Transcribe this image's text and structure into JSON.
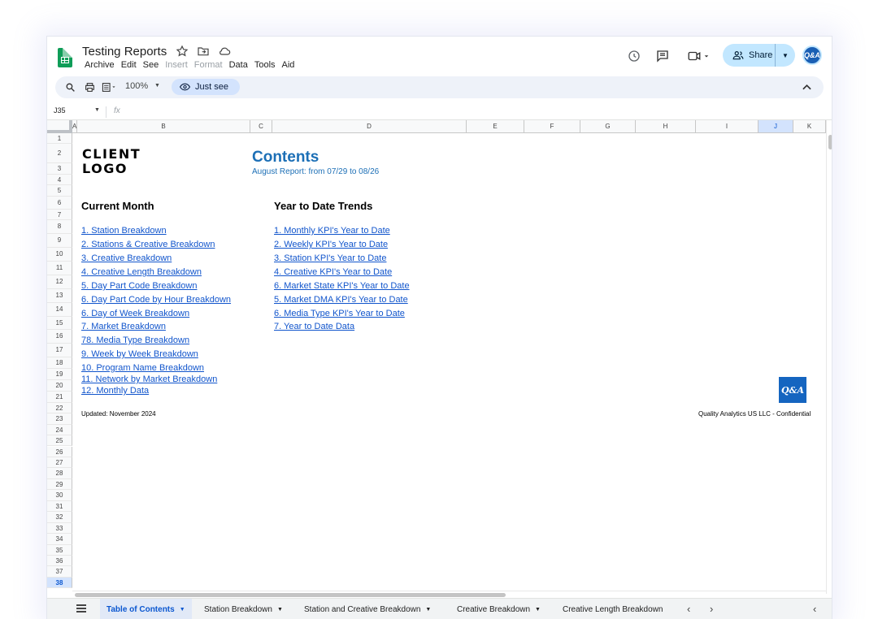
{
  "app": {
    "title": "Testing Reports",
    "menu": [
      {
        "label": "Archive",
        "disabled": false
      },
      {
        "label": "Edit",
        "disabled": false
      },
      {
        "label": "See",
        "disabled": false
      },
      {
        "label": "Insert",
        "disabled": true
      },
      {
        "label": "Format",
        "disabled": true
      },
      {
        "label": "Data",
        "disabled": false
      },
      {
        "label": "Tools",
        "disabled": false
      },
      {
        "label": "Aid",
        "disabled": false
      }
    ],
    "share_label": "Share",
    "avatar_text": "Q&A"
  },
  "toolbar": {
    "zoom": "100%",
    "view_mode": "Just see"
  },
  "formula_bar": {
    "name_box": "J35",
    "fx": "fx"
  },
  "grid": {
    "columns": [
      {
        "label": "A",
        "selected": false
      },
      {
        "label": "B",
        "selected": false
      },
      {
        "label": "C",
        "selected": false
      },
      {
        "label": "D",
        "selected": false
      },
      {
        "label": "E",
        "selected": false
      },
      {
        "label": "F",
        "selected": false
      },
      {
        "label": "G",
        "selected": false
      },
      {
        "label": "H",
        "selected": false
      },
      {
        "label": "I",
        "selected": false
      },
      {
        "label": "J",
        "selected": true
      },
      {
        "label": "K",
        "selected": false
      }
    ],
    "rows": [
      "1",
      "2",
      "3",
      "4",
      "5",
      "6",
      "7",
      "8",
      "9",
      "10",
      "11",
      "12",
      "13",
      "14",
      "15",
      "16",
      "17",
      "18",
      "19",
      "20",
      "21",
      "22",
      "23",
      "24",
      "25",
      "26",
      "27",
      "28",
      "29",
      "30",
      "31",
      "32",
      "33",
      "34",
      "35",
      "36",
      "37",
      "38"
    ],
    "selected_row": "38"
  },
  "sheet": {
    "client_logo_line1": "CLIENT",
    "client_logo_line2": "LOGO",
    "title": "Contents",
    "subtitle": "August Report: from 07/29 to 08/26",
    "current_month_heading": "Current Month",
    "ytd_heading": "Year  to Date Trends",
    "current_month_links": [
      "1. Station Breakdown",
      "2. Stations & Creative Breakdown",
      "3. Creative Breakdown",
      "4. Creative Length Breakdown",
      "5. Day Part Code Breakdown",
      "6. Day Part Code by Hour Breakdown",
      "6. Day of Week Breakdown",
      "7. Market Breakdown",
      "78. Media Type Breakdown",
      "9. Week by Week Breakdown",
      "10. Program Name Breakdown",
      "11. Network by Market Breakdown",
      "12. Monthly Data"
    ],
    "ytd_links": [
      "1. Monthly KPI's Year to Date",
      "2. Weekly KPI's Year to Date",
      "3. Station KPI's Year to Date",
      "4. Creative KPI's Year to Date",
      "6. Market State  KPI's Year to Date",
      "5. Market DMA  KPI's Year to Date",
      "6. Media Type KPI's Year to Date",
      "7. Year to Date Data"
    ],
    "updated": "Updated: November 2024",
    "confidential": "Quality Analytics US LLC - Confidential",
    "qa_logo_text": "Q&A"
  },
  "tabs": [
    {
      "label": "Table of Contents",
      "active": true
    },
    {
      "label": "Station Breakdown",
      "active": false
    },
    {
      "label": "Station and Creative Breakdown",
      "active": false
    },
    {
      "label": "Creative Breakdown",
      "active": false
    },
    {
      "label": "Creative Length Breakdown",
      "active": false
    }
  ],
  "colors": {
    "accent": "#0b57d0",
    "link": "#1155cc",
    "title_blue": "#1c6fb6",
    "share_bg": "#c2e7ff",
    "sheets_green": "#0f9d58"
  },
  "icons": [
    "sheets-logo-icon",
    "star-icon",
    "move-folder-icon",
    "cloud-icon",
    "history-icon",
    "comment-icon",
    "video-call-icon",
    "share-people-icon",
    "search-icon",
    "print-icon",
    "paint-format-icon",
    "eye-icon",
    "collapse-chevron-icon",
    "all-sheets-menu-icon"
  ]
}
